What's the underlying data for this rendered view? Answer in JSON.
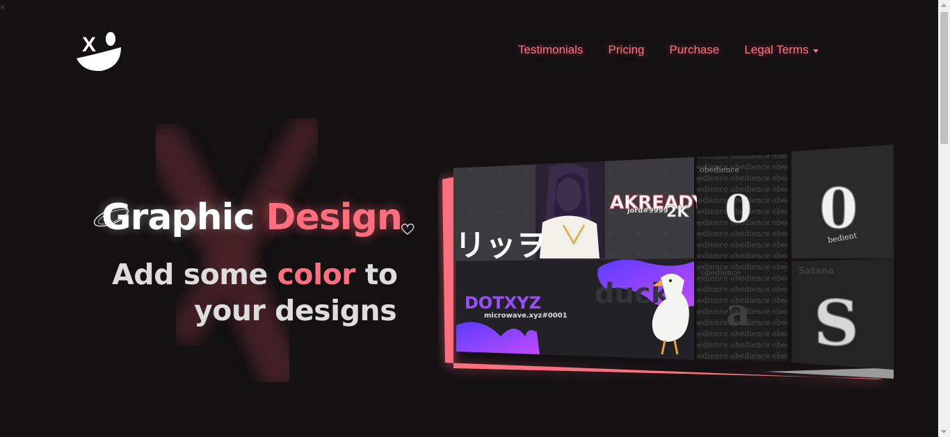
{
  "corner_mark": "x",
  "nav": {
    "items": [
      {
        "label": "Testimonials"
      },
      {
        "label": "Pricing"
      },
      {
        "label": "Purchase"
      },
      {
        "label": "Legal Terms"
      }
    ]
  },
  "hero": {
    "title_part1": "Graphic",
    "title_part2": "Design",
    "sub_part1": "Add some",
    "sub_accent": "color",
    "sub_part2": "to",
    "sub_line2": "your designs"
  },
  "showcase": {
    "banner1_name": "AKREADY",
    "banner1_badge": "2K",
    "banner1_tag": "jord#9999",
    "banner1_jp": "リッヲ",
    "banner2_name": "DOTXYZ",
    "banner2_tag": "microwave.xyz#0001",
    "banner2_bg_word": "duck",
    "tile1_letter": "0",
    "tile1_word": "obedience",
    "tile2_letter": "0",
    "tile2_word": "bedient",
    "tile3_letter": "a",
    "tile3_word": "obedience",
    "tile4_letter": "S",
    "tile4_word": "Satana"
  },
  "colors": {
    "background": "#141113",
    "accent": "#ff6f7d",
    "nav_link": "#ff7385"
  }
}
